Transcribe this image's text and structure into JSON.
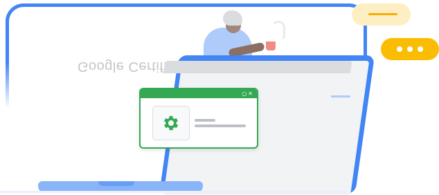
{
  "banner": {
    "mirrored_title": "Google Certified Trainer"
  },
  "chat_bubble": {
    "dots_count": 3
  },
  "settings_window": {
    "window_controls": [
      "○",
      "✕"
    ],
    "icon": "gear-icon"
  },
  "colors": {
    "blue": "#4285F4",
    "green": "#34A853",
    "yellow": "#FBBC04",
    "light_yellow": "#FEEFC3"
  }
}
